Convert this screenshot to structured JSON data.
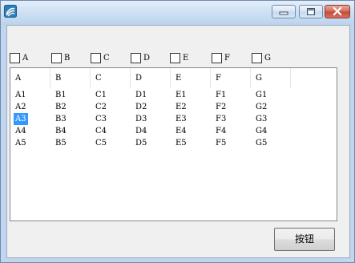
{
  "window": {
    "icon": "app-icon",
    "controls": {
      "minimize": "minimize-icon",
      "maximize": "maximize-icon",
      "close": "close-icon"
    }
  },
  "checkboxes": [
    {
      "label": "A",
      "checked": false
    },
    {
      "label": "B",
      "checked": false
    },
    {
      "label": "C",
      "checked": false
    },
    {
      "label": "D",
      "checked": false
    },
    {
      "label": "E",
      "checked": false
    },
    {
      "label": "F",
      "checked": false
    },
    {
      "label": "G",
      "checked": false
    }
  ],
  "listview": {
    "columns": [
      "A",
      "B",
      "C",
      "D",
      "E",
      "F",
      "G"
    ],
    "rows": [
      [
        "A1",
        "B1",
        "C1",
        "D1",
        "E1",
        "F1",
        "G1"
      ],
      [
        "A2",
        "B2",
        "C2",
        "D2",
        "E2",
        "F2",
        "G2"
      ],
      [
        "A3",
        "B3",
        "C3",
        "D3",
        "E3",
        "F3",
        "G3"
      ],
      [
        "A4",
        "B4",
        "C4",
        "D4",
        "E4",
        "F4",
        "G4"
      ],
      [
        "A5",
        "B5",
        "C5",
        "D5",
        "E5",
        "F5",
        "G5"
      ]
    ],
    "selected_cell": "A3",
    "selection_color": "#3399ff"
  },
  "button": {
    "label": "按钮"
  }
}
